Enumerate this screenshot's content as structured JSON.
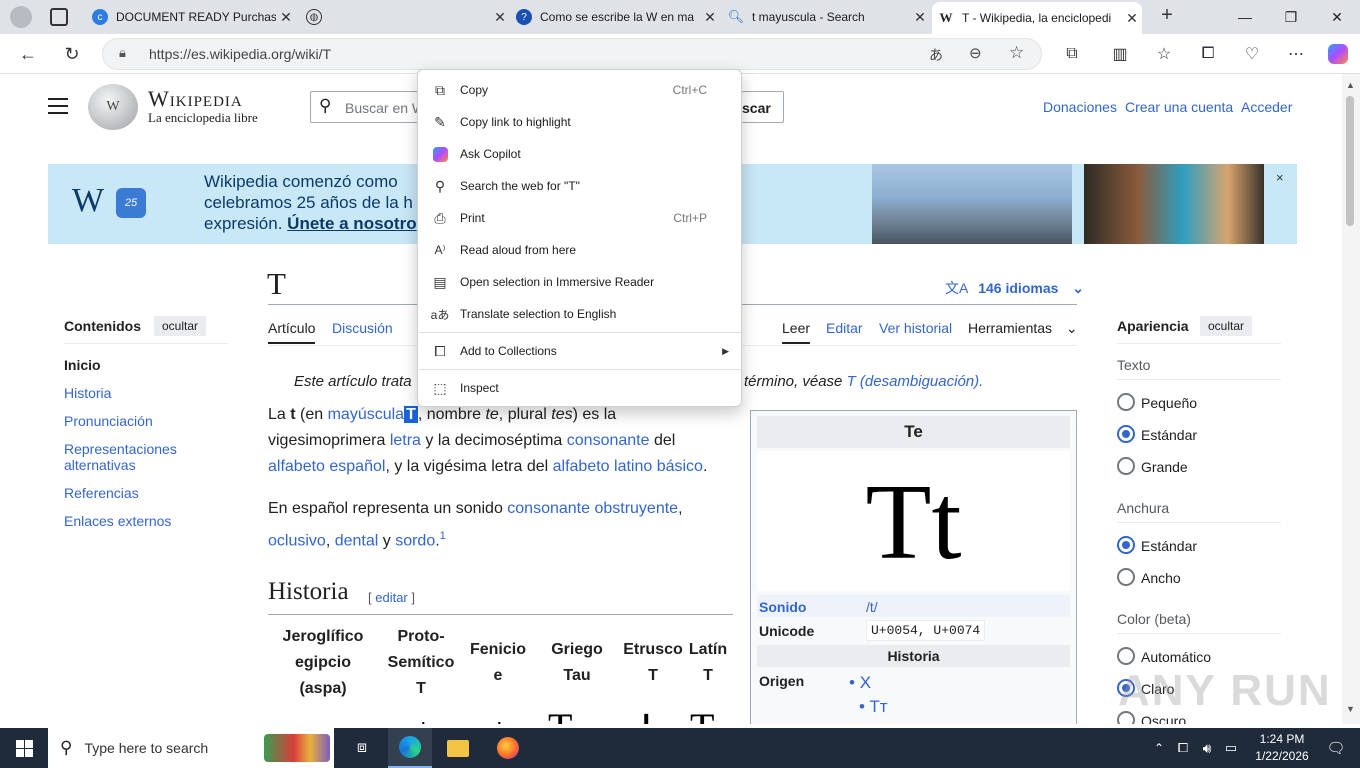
{
  "tabs": [
    {
      "title": "DOCUMENT READY Purchas",
      "favicon": "copilot-favicon"
    },
    {
      "title": "",
      "favicon": "globe-favicon"
    },
    {
      "title": "Como se escribe la W en ma",
      "favicon": "help-favicon"
    },
    {
      "title": "t mayuscula - Search",
      "favicon": "search-favicon"
    },
    {
      "title": "T - Wikipedia, la enciclopedi",
      "favicon": "wikipedia-favicon",
      "active": true
    }
  ],
  "address": {
    "url": "https://es.wikipedia.org/wiki/T"
  },
  "wiki": {
    "wordmark": "Wikipedia",
    "tagline": "La enciclopedia libre",
    "search_placeholder": "Buscar en W",
    "search_button": "scar",
    "donate": "Donaciones",
    "create_account": "Crear una cuenta",
    "login": "Acceder",
    "banner": {
      "line1": "Wikipedia comenzó como",
      "line2": "celebramos 25 años de la h",
      "line3": "expresión.",
      "join": "Únete a nosotro",
      "close": "×",
      "logo": "W",
      "logo_badge": "25"
    },
    "page_title": "T",
    "languages": "146 idiomas",
    "tabs_left": [
      "Artículo",
      "Discusión"
    ],
    "tabs_right": [
      "Leer",
      "Editar",
      "Ver historial",
      "Herramientas"
    ],
    "toc": {
      "title": "Contenidos",
      "hide": "ocultar",
      "items": [
        "Inicio",
        "Historia",
        "Pronunciación",
        "Representaciones alternativas",
        "Referencias",
        "Enlaces externos"
      ]
    },
    "hatnote_start": "Este artículo trata",
    "hatnote_end": "término, véase",
    "hatnote_link": "T (desambiguación).",
    "para1": {
      "t1": "La ",
      "b": "t",
      "t2": " (en ",
      "l1": "mayúscula",
      "sel": "T",
      "t3": ", nombre ",
      "i1": "te",
      "t4": ", plural ",
      "i2": "tes",
      "t5": ") es la",
      "t6": "vigesimoprimera ",
      "l2": "letra",
      "t7": " y la decimoséptima ",
      "l3": "consonante",
      "t8": " del",
      "l4": "alfabeto español",
      "t9": ", y la vigésima letra del ",
      "l5": "alfabeto latino básico",
      "t10": "."
    },
    "para2": {
      "t1": "En español representa un sonido ",
      "l1": "consonante obstruyente",
      "t2": ",",
      "l2": "oclusivo",
      "t3": ", ",
      "l3": "dental",
      "t4": " y ",
      "l4": "sordo",
      "t5": ".",
      "sup": "1"
    },
    "history_heading": "Historia",
    "edit_link": "editar",
    "history_table_headers": [
      "Jeroglífico egipcio (aspa)",
      "Proto-Semítico T",
      "Fenicio e",
      "Griego Tau",
      "Etrusco T",
      "Latín T"
    ],
    "infobox": {
      "title": "Te",
      "glyph": "Tt",
      "sound_label": "Sonido",
      "sound_value": "/t/",
      "unicode_label": "Unicode",
      "unicode_value": "U+0054, U+0074",
      "history_label": "Historia",
      "origin_label": "Origen",
      "origin_items": [
        "X",
        "Tт"
      ]
    },
    "appearance": {
      "title": "Apariencia",
      "hide": "ocultar",
      "text_label": "Texto",
      "text_options": [
        "Pequeño",
        "Estándar",
        "Grande"
      ],
      "text_selected": 1,
      "width_label": "Anchura",
      "width_options": [
        "Estándar",
        "Ancho"
      ],
      "width_selected": 0,
      "color_label": "Color (beta)",
      "color_options": [
        "Automático",
        "Claro",
        "Oscuro"
      ],
      "color_selected": 1
    }
  },
  "context_menu": [
    {
      "label": "Copy",
      "shortcut": "Ctrl+C",
      "icon": "copy-icon"
    },
    {
      "label": "Copy link to highlight",
      "shortcut": "",
      "icon": "link-highlight-icon"
    },
    {
      "label": "Ask Copilot",
      "shortcut": "",
      "icon": "copilot-icon"
    },
    {
      "label": "Search the web for \"T\"",
      "shortcut": "",
      "icon": "search-icon"
    },
    {
      "label": "Print",
      "shortcut": "Ctrl+P",
      "icon": "print-icon"
    },
    {
      "label": "Read aloud from here",
      "shortcut": "",
      "icon": "read-aloud-icon"
    },
    {
      "label": "Open selection in Immersive Reader",
      "shortcut": "",
      "icon": "immersive-reader-icon"
    },
    {
      "label": "Translate selection to English",
      "shortcut": "",
      "icon": "translate-icon"
    },
    {
      "label": "Add to Collections",
      "shortcut": "",
      "icon": "collections-icon",
      "submenu": true
    },
    {
      "label": "Inspect",
      "shortcut": "",
      "icon": "inspect-icon"
    }
  ],
  "taskbar": {
    "search_placeholder": "Type here to search",
    "time": "1:24 PM",
    "date": "1/22/2026"
  },
  "watermark": "ANY RUN"
}
